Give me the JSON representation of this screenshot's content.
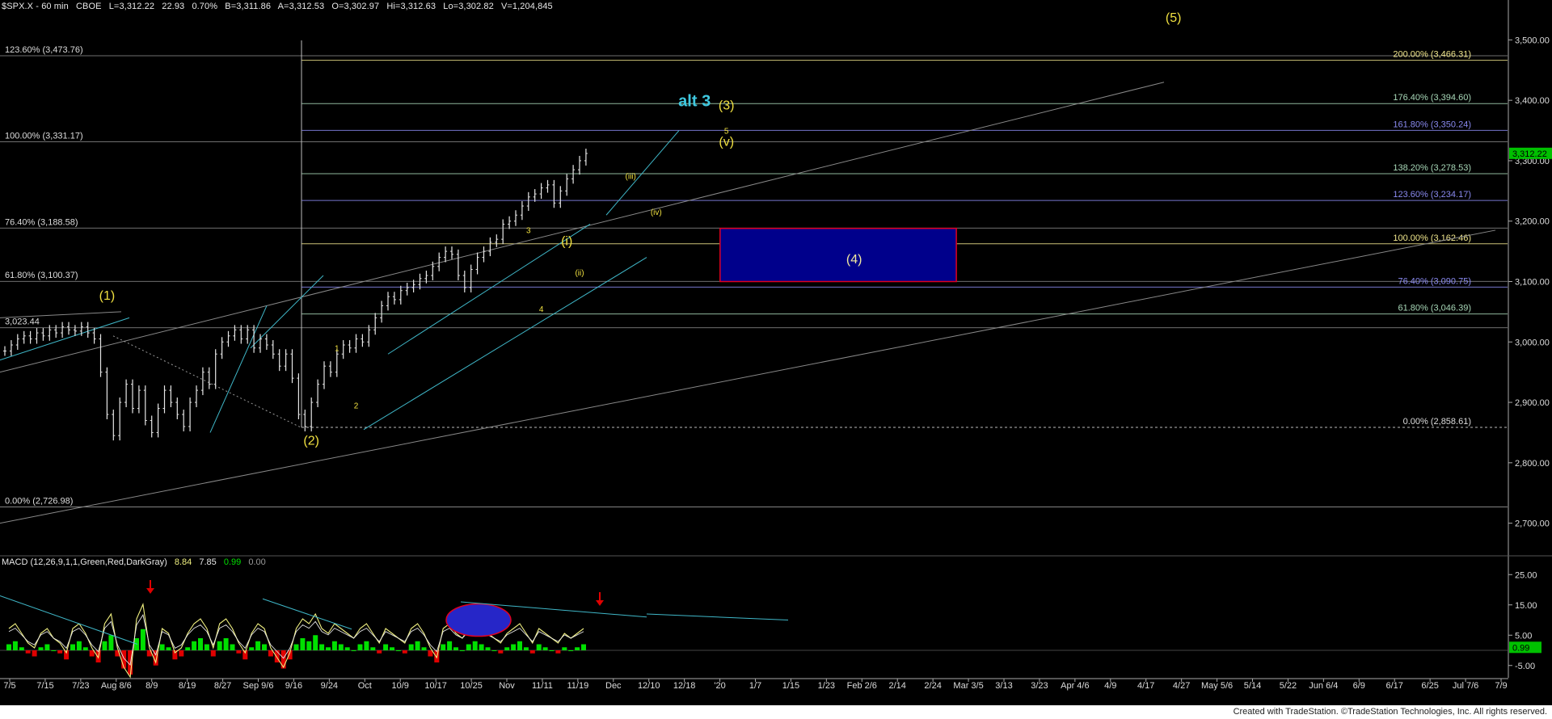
{
  "header": {
    "symbol": "$SPX.X - 60 min",
    "exchange": "CBOE",
    "last": "L=3,312.22",
    "change": "22.93",
    "change_pct": "0.70%",
    "bid": "B=3,311.86",
    "ask": "A=3,312.53",
    "open": "O=3,302.97",
    "high": "Hi=3,312.63",
    "low": "Lo=3,302.82",
    "volume": "V=1,204,845"
  },
  "macd_header": {
    "label": "MACD (12,26,9,1,1,Green,Red,DarkGray)",
    "v1": "8.84",
    "v2": "7.85",
    "v3": "0.99",
    "v4": "0.00"
  },
  "footer_text": "Created with TradeStation. ©TradeStation Technologies, Inc. All rights reserved.",
  "colors": {
    "background": "#000000",
    "price_bars": "#e6e6e6",
    "fib_left": "#c8c8c8",
    "fib_right_green": "#a8d8b8",
    "fib_yellow": "#f0e68c",
    "fib_blue": "#8a8af0",
    "channel": "#3fb7c8",
    "wave_label": "#f0e040",
    "alt3_label": "#3fc8e0",
    "box_fill": "#00008b",
    "box_border": "#e00020",
    "macd_up": "#00e000",
    "macd_down": "#e00000",
    "macd_line": "#f0f080",
    "signal_line": "#e8e8e8",
    "arrow": "#e00000",
    "current_price_box": "#00c000"
  },
  "chart_data": [
    {
      "type": "line",
      "title": "$SPX.X - 60 min",
      "ylim": [
        2650,
        3550
      ],
      "y_ticks": [
        "3,500.00",
        "3,400.00",
        "3,300.00",
        "3,200.00",
        "3,100.00",
        "3,000.00",
        "2,900.00",
        "2,800.00",
        "2,700.00"
      ],
      "y_tick_values": [
        3500,
        3400,
        3300,
        3200,
        3100,
        3000,
        2900,
        2800,
        2700
      ],
      "x_ticks": [
        "7/5",
        "7/15",
        "7/23",
        "Aug 8/6",
        "8/9",
        "8/19",
        "8/27",
        "Sep 9/6",
        "9/16",
        "9/24",
        "Oct",
        "10/9",
        "10/17",
        "10/25",
        "Nov",
        "11/11",
        "11/19",
        "Dec",
        "12/10",
        "12/18",
        "'20",
        "1/7",
        "1/15",
        "1/23",
        "Feb 2/6",
        "2/14",
        "2/24",
        "Mar 3/5",
        "3/13",
        "3/23",
        "Apr 4/6",
        "4/9",
        "4/17",
        "4/27",
        "May 5/6",
        "5/14",
        "5/22",
        "Jun 6/4",
        "6/9",
        "6/17",
        "6/25",
        "Jul 7/6",
        "7/9"
      ],
      "current_price": "3,312.22",
      "current_price_value": 3312.22,
      "series": [
        {
          "name": "$SPX.X",
          "points": [
            [
              0,
              2985
            ],
            [
              1,
              2995
            ],
            [
              2,
              3005
            ],
            [
              3,
              3010
            ],
            [
              4,
              3005
            ],
            [
              5,
              3015
            ],
            [
              6,
              3010
            ],
            [
              7,
              3020
            ],
            [
              8,
              3015
            ],
            [
              9,
              3025
            ],
            [
              10,
              3020
            ],
            [
              11,
              3018
            ],
            [
              12,
              3025
            ],
            [
              13,
              3015
            ],
            [
              14,
              3005
            ],
            [
              15,
              2950
            ],
            [
              16,
              2880
            ],
            [
              17,
              2845
            ],
            [
              18,
              2900
            ],
            [
              19,
              2930
            ],
            [
              20,
              2890
            ],
            [
              21,
              2920
            ],
            [
              22,
              2870
            ],
            [
              23,
              2850
            ],
            [
              24,
              2890
            ],
            [
              25,
              2920
            ],
            [
              26,
              2900
            ],
            [
              27,
              2880
            ],
            [
              28,
              2860
            ],
            [
              29,
              2900
            ],
            [
              30,
              2920
            ],
            [
              31,
              2950
            ],
            [
              32,
              2930
            ],
            [
              33,
              2980
            ],
            [
              34,
              3000
            ],
            [
              35,
              3010
            ],
            [
              36,
              3020
            ],
            [
              37,
              3005
            ],
            [
              38,
              3020
            ],
            [
              39,
              2990
            ],
            [
              40,
              3005
            ],
            [
              41,
              2995
            ],
            [
              42,
              2980
            ],
            [
              43,
              2960
            ],
            [
              44,
              2980
            ],
            [
              45,
              2940
            ],
            [
              46,
              2880
            ],
            [
              47,
              2860
            ],
            [
              48,
              2900
            ],
            [
              49,
              2930
            ],
            [
              50,
              2960
            ],
            [
              51,
              2950
            ],
            [
              52,
              2980
            ],
            [
              53,
              2995
            ],
            [
              54,
              2990
            ],
            [
              55,
              3005
            ],
            [
              56,
              3000
            ],
            [
              57,
              3020
            ],
            [
              58,
              3040
            ],
            [
              59,
              3060
            ],
            [
              60,
              3075
            ],
            [
              61,
              3070
            ],
            [
              62,
              3085
            ],
            [
              63,
              3090
            ],
            [
              64,
              3095
            ],
            [
              65,
              3105
            ],
            [
              66,
              3110
            ],
            [
              67,
              3125
            ],
            [
              68,
              3140
            ],
            [
              69,
              3150
            ],
            [
              70,
              3145
            ],
            [
              71,
              3110
            ],
            [
              72,
              3090
            ],
            [
              73,
              3120
            ],
            [
              74,
              3140
            ],
            [
              75,
              3150
            ],
            [
              76,
              3165
            ],
            [
              77,
              3170
            ],
            [
              78,
              3195
            ],
            [
              79,
              3200
            ],
            [
              80,
              3210
            ],
            [
              81,
              3225
            ],
            [
              82,
              3240
            ],
            [
              83,
              3245
            ],
            [
              84,
              3255
            ],
            [
              85,
              3260
            ],
            [
              86,
              3230
            ],
            [
              87,
              3250
            ],
            [
              88,
              3270
            ],
            [
              89,
              3285
            ],
            [
              90,
              3300
            ],
            [
              91,
              3312
            ]
          ]
        }
      ],
      "fib_left": [
        {
          "label": "123.60% (3,473.76)",
          "value": 3473.76
        },
        {
          "label": "100.00% (3,331.17)",
          "value": 3331.17
        },
        {
          "label": "76.40% (3,188.58)",
          "value": 3188.58
        },
        {
          "label": "61.80% (3,100.37)",
          "value": 3100.37
        },
        {
          "label": "3,023.44",
          "value": 3023.44
        },
        {
          "label": "0.00% (2,726.98)",
          "value": 2726.98
        }
      ],
      "fib_right": [
        {
          "label": "200.00% (3,466.31)",
          "value": 3466.31,
          "color": "yellow"
        },
        {
          "label": "176.40% (3,394.60)",
          "value": 3394.6,
          "color": "green"
        },
        {
          "label": "161.80% (3,350.24)",
          "value": 3350.24,
          "color": "blue"
        },
        {
          "label": "138.20% (3,278.53)",
          "value": 3278.53,
          "color": "green"
        },
        {
          "label": "123.60% (3,234.17)",
          "value": 3234.17,
          "color": "blue"
        },
        {
          "label": "100.00% (3,162.46)",
          "value": 3162.46,
          "color": "yellow"
        },
        {
          "label": "76.40% (3,090.75)",
          "value": 3090.75,
          "color": "blue"
        },
        {
          "label": "61.80% (3,046.39)",
          "value": 3046.39,
          "color": "green"
        },
        {
          "label": "0.00% (2,858.61)",
          "value": 2858.61,
          "color": "white"
        }
      ],
      "wave_labels": [
        {
          "text": "(1)",
          "x": 16,
          "y": 3070
        },
        {
          "text": "(2)",
          "x": 48,
          "y": 2830
        },
        {
          "text": "1",
          "x": 52,
          "y": 2985
        },
        {
          "text": "2",
          "x": 55,
          "y": 2890
        },
        {
          "text": "3",
          "x": 82,
          "y": 3180
        },
        {
          "text": "4",
          "x": 84,
          "y": 3050
        },
        {
          "text": "(i)",
          "x": 88,
          "y": 3160
        },
        {
          "text": "(ii)",
          "x": 90,
          "y": 3110
        },
        {
          "text": "(iii)",
          "x": 98,
          "y": 3270
        },
        {
          "text": "(iv)",
          "x": 102,
          "y": 3210
        },
        {
          "text": "5",
          "x": 113,
          "y": 3345
        },
        {
          "text": "(v)",
          "x": 113,
          "y": 3325
        },
        {
          "text": "(3)",
          "x": 113,
          "y": 3385
        },
        {
          "text": "(5)",
          "x": 183,
          "y": 3530
        },
        {
          "text": "(4)",
          "x": 133,
          "y": 3130
        }
      ],
      "alt_label": {
        "text": "alt 3",
        "x": 108,
        "y": 3390
      },
      "wave4_box": {
        "x0": 112,
        "x1": 149,
        "y0": 3100,
        "y1": 3188
      }
    },
    {
      "type": "bar",
      "title": "MACD (12,26,9,1,1,Green,Red,DarkGray)",
      "ylim": [
        -8,
        28
      ],
      "y_ticks": [
        "25.00",
        "15.00",
        "5.00",
        "-5.00"
      ],
      "y_tick_values": [
        25,
        15,
        5,
        -5
      ],
      "current_value": "0.99",
      "histogram": [
        2,
        3,
        1,
        -1,
        -2,
        1,
        2,
        0,
        -1,
        -3,
        2,
        3,
        1,
        -2,
        -4,
        3,
        5,
        -2,
        -6,
        -8,
        4,
        7,
        -2,
        -5,
        2,
        1,
        -3,
        -2,
        1,
        3,
        4,
        2,
        -2,
        3,
        4,
        2,
        -1,
        -3,
        1,
        3,
        2,
        -2,
        -4,
        -6,
        -3,
        2,
        4,
        3,
        5,
        2,
        1,
        3,
        2,
        1,
        0,
        2,
        3,
        1,
        -1,
        2,
        1,
        0,
        -1,
        2,
        3,
        1,
        -2,
        -4,
        2,
        3,
        1,
        0,
        2,
        3,
        2,
        1,
        0,
        -1,
        1,
        2,
        3,
        1,
        -1,
        2,
        1,
        0,
        -1,
        1,
        0,
        1,
        2
      ]
    }
  ]
}
